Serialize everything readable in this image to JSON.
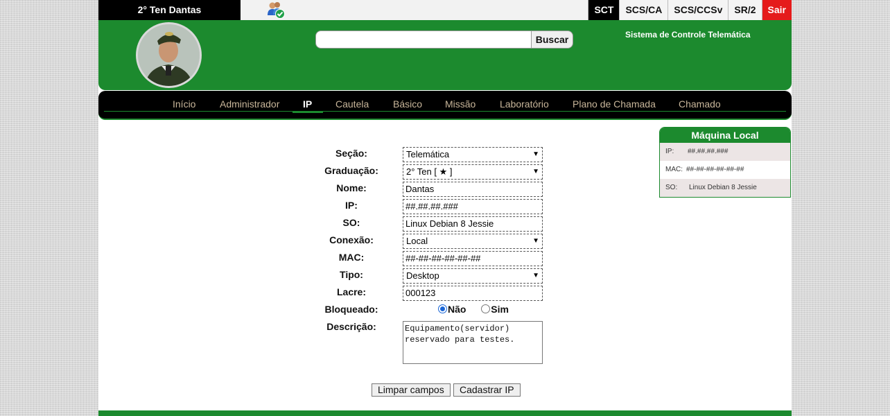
{
  "user": {
    "name": "2° Ten Dantas"
  },
  "systems": [
    {
      "label": "SCT"
    },
    {
      "label": "SCS/CA"
    },
    {
      "label": "SCS/CCSv"
    },
    {
      "label": "SR/2"
    },
    {
      "label": "Sair"
    }
  ],
  "search": {
    "value": "",
    "button_label": "Buscar"
  },
  "header": {
    "system_title": "Sistema de Controle Telemática"
  },
  "nav": [
    {
      "label": "Início"
    },
    {
      "label": "Administrador"
    },
    {
      "label": "IP"
    },
    {
      "label": "Cautela"
    },
    {
      "label": "Básico"
    },
    {
      "label": "Missão"
    },
    {
      "label": "Laboratório"
    },
    {
      "label": "Plano de Chamada"
    },
    {
      "label": "Chamado"
    }
  ],
  "machine": {
    "title": "Máquina Local",
    "rows": [
      {
        "key": "IP:",
        "value": "##.##.##.###"
      },
      {
        "key": "MAC:",
        "value": "##-##-##-##-##-##"
      },
      {
        "key": "SO:",
        "value": "Linux Debian 8 Jessie"
      }
    ]
  },
  "form": {
    "secao": {
      "label": "Seção:",
      "value": "Telemática"
    },
    "graduacao": {
      "label": "Graduação:",
      "value": "2° Ten [ ★ ]"
    },
    "nome": {
      "label": "Nome:",
      "value": "Dantas"
    },
    "ip": {
      "label": "IP:",
      "value": "##.##.##.###"
    },
    "so": {
      "label": "SO:",
      "value": "Linux Debian 8 Jessie"
    },
    "conexao": {
      "label": "Conexão:",
      "value": "Local"
    },
    "mac": {
      "label": "MAC:",
      "value": "##-##-##-##-##-##"
    },
    "tipo": {
      "label": "Tipo:",
      "value": "Desktop"
    },
    "lacre": {
      "label": "Lacre:",
      "value": "000123"
    },
    "bloqueado": {
      "label": "Bloqueado:",
      "option_no": "Não",
      "option_yes": "Sim",
      "selected": "Não"
    },
    "descricao": {
      "label": "Descrição:",
      "value": "Equipamento(servidor)\nreservado para testes."
    },
    "clear_label": "Limpar campos",
    "submit_label": "Cadastrar IP"
  },
  "colors": {
    "brand_green": "#1c8a2e",
    "exit_red": "#e51b1b",
    "nav_text": "#c8b69a"
  }
}
